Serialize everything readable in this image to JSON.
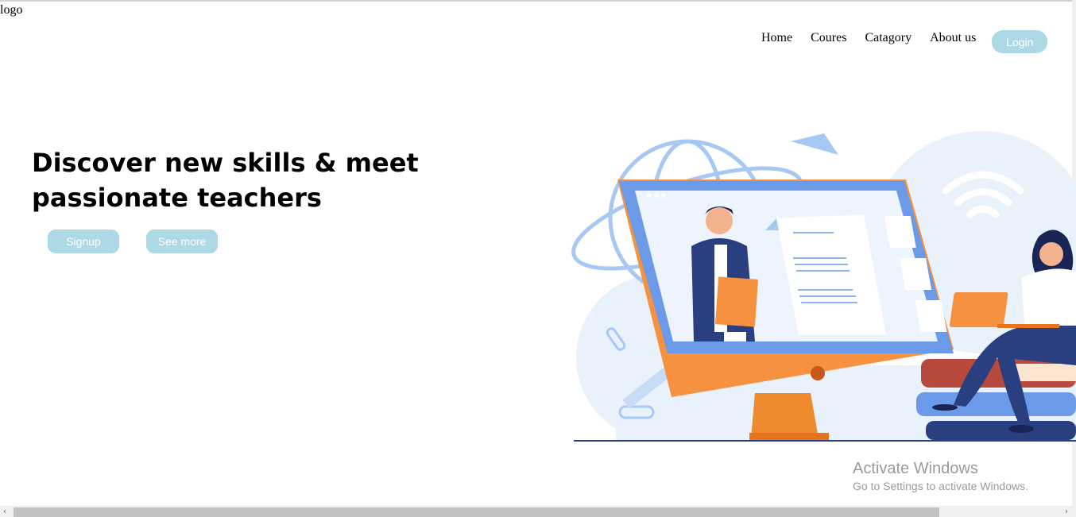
{
  "logo": "logo",
  "nav": {
    "home": "Home",
    "courses": "Coures",
    "category": "Catagory",
    "about": "About us",
    "login": "Login"
  },
  "hero": {
    "title": "Discover new skills & meet passionate teachers",
    "signup": "Signup",
    "see_more": "See more"
  },
  "watermark": {
    "title": "Activate Windows",
    "subtitle": "Go to Settings to activate Windows."
  },
  "scrollbar": {
    "left_arrow": "‹",
    "right_arrow": "›"
  },
  "colors": {
    "button_bg": "#add8e6",
    "button_text": "#ffffff",
    "monitor_orange": "#f6913f",
    "monitor_blue": "#6b9ae8",
    "navy": "#2a3f7f"
  }
}
